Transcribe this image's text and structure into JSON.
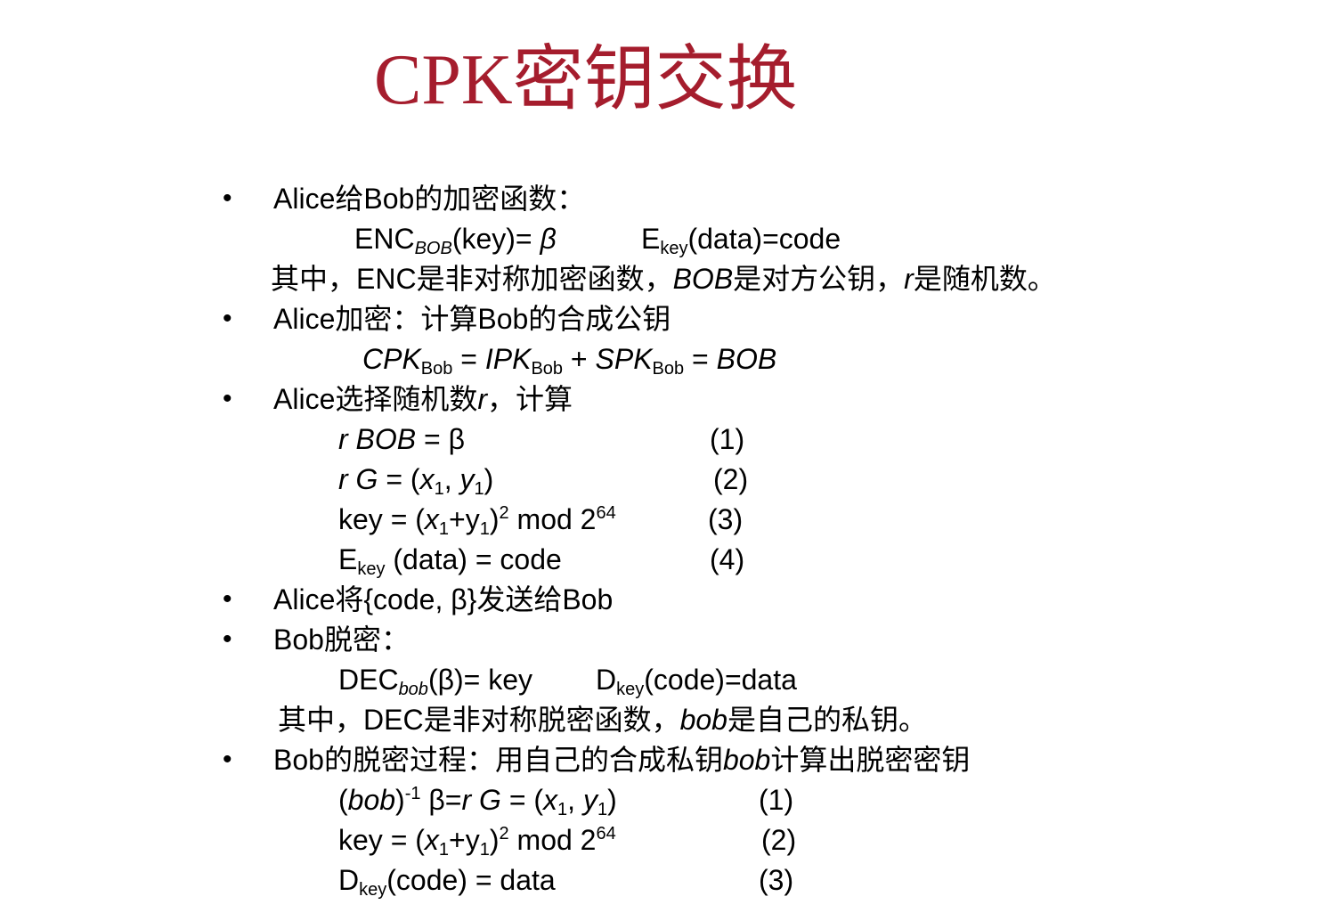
{
  "title": "CPK密钥交换",
  "b1": {
    "text": "Alice给Bob的加密函数："
  },
  "enc": {
    "a": "ENC",
    "a_sub": "BOB",
    "a_rest": "(key)= ",
    "beta": "β",
    "e": "E",
    "e_sub": "key",
    "e_rest": "(data)=code"
  },
  "note1": {
    "p1": "其中，ENC是非对称加密函数，",
    "bob": "BOB",
    "p2": "是对方公钥，",
    "r": "r",
    "p3": "是随机数。"
  },
  "b2": {
    "text": "Alice加密：计算Bob的合成公钥"
  },
  "cpk": {
    "c": "CPK",
    "s": "Bob",
    "eq1": " = ",
    "i": "IPK",
    "plus": " + ",
    "sp": "SPK",
    "eq2": " = ",
    "bob": "BOB"
  },
  "b3": {
    "p1": "Alice选择随机数",
    "r": "r",
    "p2": "，计算"
  },
  "steps1": {
    "s1": {
      "r": "r BOB",
      "rest": " = β",
      "num": "(1)"
    },
    "s2": {
      "r": "r G",
      "eq": " = (",
      "x": "x",
      "one": "1",
      "comma": ", ",
      "y": "y",
      "one2": "1",
      "close": ")",
      "num": "(2)"
    },
    "s3": {
      "key": "key = (",
      "x": "x",
      "one": "1",
      "plus": "+y",
      "one2": "1",
      "close": ")",
      "two": "2",
      "mod": " mod 2",
      "exp": "64",
      "num": "(3)"
    },
    "s4": {
      "e": "E",
      "sub": "key",
      "rest": " (data) = code",
      "num": "(4)"
    }
  },
  "b4": {
    "text": "Alice将{code, β}发送给Bob"
  },
  "b5": {
    "text": "Bob脱密："
  },
  "dec": {
    "a": "DEC",
    "a_sub": "bob",
    "a_rest": "(β)= key",
    "d": "D",
    "d_sub": "key",
    "d_rest": "(code)=data"
  },
  "note2": {
    "p1": "其中，DEC是非对称脱密函数，",
    "bob": "bob",
    "p2": "是自己的私钥。"
  },
  "b6": {
    "p1": "Bob的脱密过程：用自己的合成私钥",
    "bob": "bob",
    "p2": "计算出脱密密钥"
  },
  "steps2": {
    "s1": {
      "open": "(",
      "bob": "bob",
      "close": ")",
      "exp": "-1",
      "rest": " β=",
      "rg": "r G",
      "eq": " = (",
      "x": "x",
      "one": "1",
      "comma": ", ",
      "y": "y",
      "one2": "1",
      "close2": ")",
      "num": "(1)"
    },
    "s2": {
      "key": "key = (",
      "x": "x",
      "one": "1",
      "plus": "+y",
      "one2": "1",
      "close": ")",
      "two": "2",
      "mod": " mod 2",
      "exp": "64",
      "num": "(2)"
    },
    "s3": {
      "d": "D",
      "sub": "key",
      "rest": "(code) = data",
      "num": "(3)"
    }
  }
}
